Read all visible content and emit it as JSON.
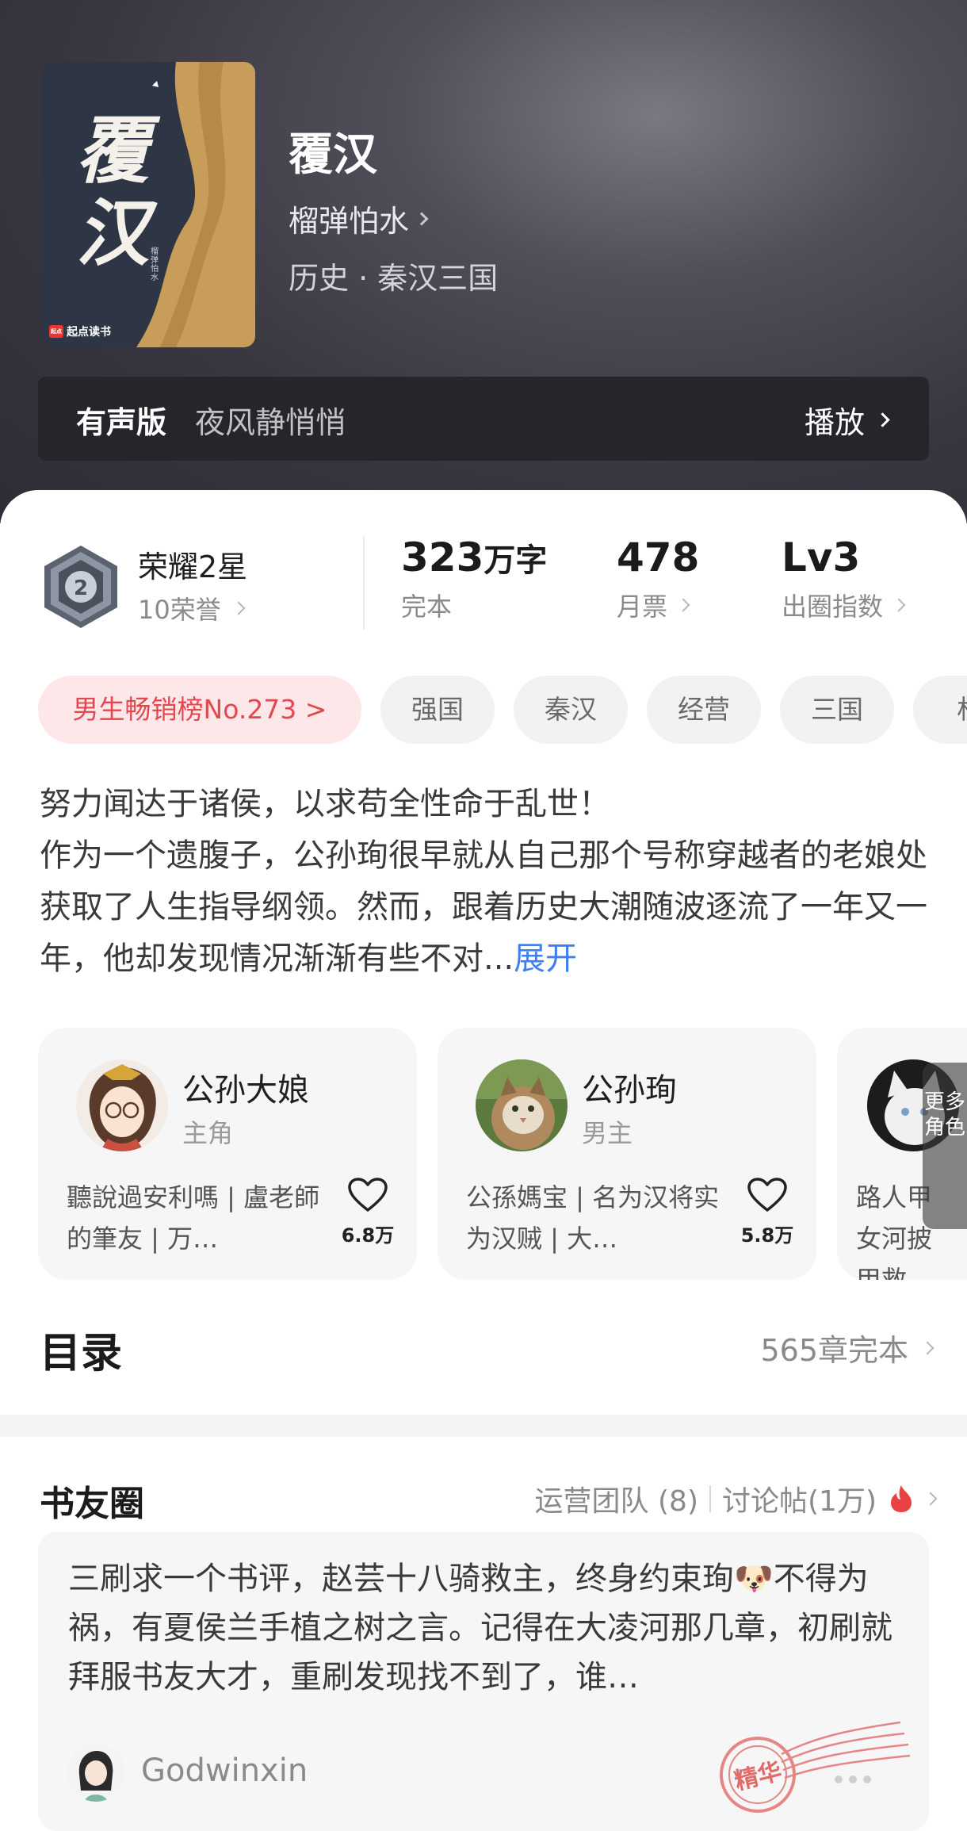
{
  "book": {
    "cover_title": "覆汉",
    "cover_author": "榴弹怕水",
    "cover_publisher": "起点读书",
    "cover_publisher_logo": "起点",
    "title": "覆汉",
    "author": "榴弹怕水",
    "category": "历史 · 秦汉三国"
  },
  "audio": {
    "label": "有声版",
    "narrator": "夜风静悄悄",
    "play_label": "播放"
  },
  "honor": {
    "title": "荣耀2星",
    "subtitle": "10荣誉",
    "level": "2"
  },
  "stats": [
    {
      "value": "323",
      "unit": "万字",
      "label": "完本"
    },
    {
      "value": "478",
      "unit": "",
      "label": "月票"
    },
    {
      "value": "Lv3",
      "unit": "",
      "label": "出圈指数"
    }
  ],
  "tags": [
    "男生畅销榜No.273 >",
    "强国",
    "秦汉",
    "经营",
    "三国",
    "权"
  ],
  "synopsis": {
    "line1": "努力闻达于诸侯，以求苟全性命于乱世！",
    "body": "作为一个遗腹子，公孙珣很早就从自己那个号称穿越者的老娘处获取了人生指导纲领。然而，跟着历史大潮随波逐流了一年又一年，他却发现情况渐渐有些不对...",
    "expand": "展开"
  },
  "characters": [
    {
      "name": "公孙大娘",
      "role": "主角",
      "desc": "聽說過安利嗎 | 盧老師的筆友 | 万…",
      "likes": "6.8万"
    },
    {
      "name": "公孙珣",
      "role": "男主",
      "desc": "公孫媽宝 | 名为汉将实为汉贼 | 大…",
      "likes": "5.8万"
    },
    {
      "name": "",
      "role": "",
      "desc": "路人甲女河披甲救",
      "likes": ""
    }
  ],
  "more_characters": "更多角色",
  "toc": {
    "title": "目录",
    "status": "565章完本"
  },
  "book_circle": {
    "title": "书友圈",
    "ops_team": "运营团队 (8)",
    "discussions": "讨论帖(1万)",
    "post": {
      "text": "三刷求一个书评，赵芸十八骑救主，终身约束珣🐶不得为祸，有夏侯兰手植之树之言。记得在大凌河那几章，初刷就拜服书友大才，重刷发现找不到了，谁…",
      "username": "Godwinxin",
      "stamp": "精华"
    }
  },
  "colors": {
    "rank_tag": "#e2484f",
    "expand_link": "#3d7ff0",
    "fire": "#e84242"
  }
}
